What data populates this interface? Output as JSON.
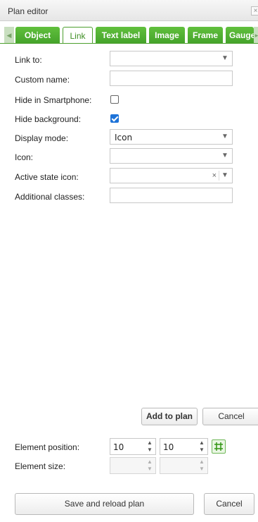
{
  "window": {
    "title": "Plan editor",
    "close_glyph": "×"
  },
  "tabs": [
    {
      "label": "Object",
      "active": false
    },
    {
      "label": "Link",
      "active": true
    },
    {
      "label": "Text label",
      "active": false
    },
    {
      "label": "Image",
      "active": false
    },
    {
      "label": "Frame",
      "active": false
    },
    {
      "label": "Gauge",
      "active": false
    }
  ],
  "form": {
    "link_to": {
      "label": "Link to:",
      "value": ""
    },
    "custom_name": {
      "label": "Custom name:",
      "value": ""
    },
    "hide_smartphone": {
      "label": "Hide in Smartphone:",
      "checked": false
    },
    "hide_background": {
      "label": "Hide background:",
      "checked": true
    },
    "display_mode": {
      "label": "Display mode:",
      "value": "Icon"
    },
    "icon": {
      "label": "Icon:",
      "value": ""
    },
    "active_state_icon": {
      "label": "Active state icon:",
      "value": "",
      "clear_glyph": "×"
    },
    "additional_classes": {
      "label": "Additional classes:",
      "value": ""
    }
  },
  "actions": {
    "add_label": "Add to plan",
    "cancel_label": "Cancel"
  },
  "position": {
    "label": "Element position:",
    "x": "10",
    "y": "10"
  },
  "size": {
    "label": "Element size:",
    "w": "",
    "h": ""
  },
  "footer": {
    "save_label": "Save and reload plan",
    "cancel_label": "Cancel"
  },
  "colors": {
    "tab_green": "#52b334",
    "checkbox_blue": "#1e73d8",
    "grid_icon_green": "#3a9a1c"
  }
}
